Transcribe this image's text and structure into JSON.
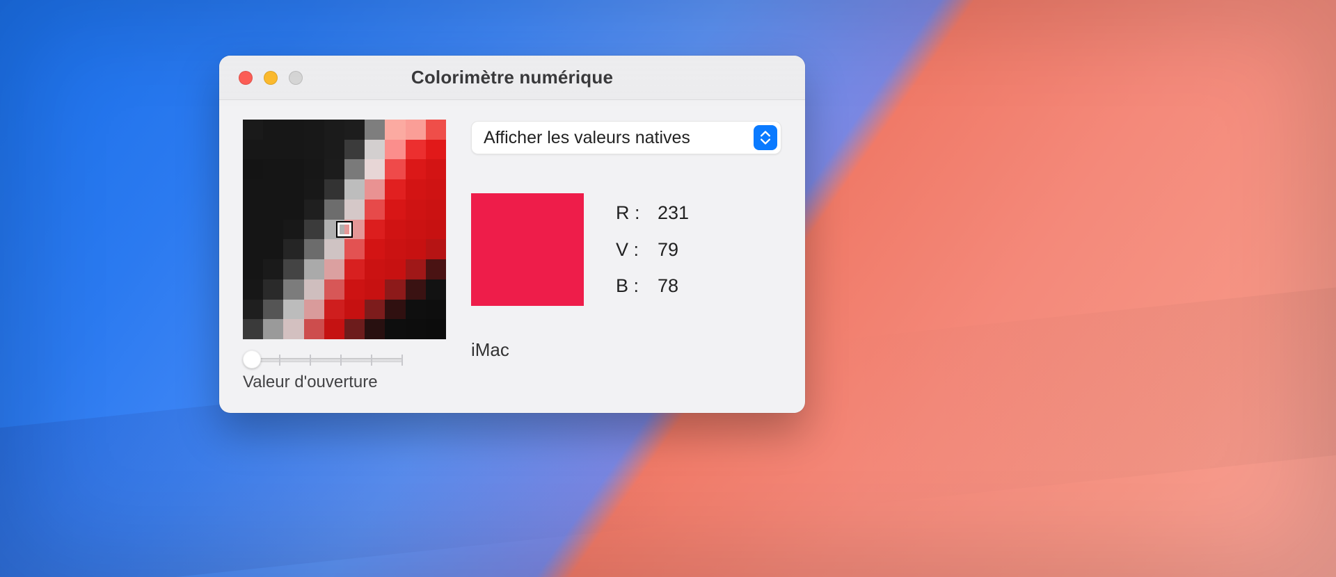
{
  "window": {
    "title": "Colorimètre numérique"
  },
  "select": {
    "value": "Afficher les valeurs natives"
  },
  "sample": {
    "swatch_hex": "#ee1d4a",
    "labels": {
      "r": "R :",
      "g": "V :",
      "b": "B :"
    },
    "r": "231",
    "g": "79",
    "b": "78"
  },
  "display": {
    "name": "iMac"
  },
  "slider": {
    "label": "Valeur d'ouverture"
  },
  "loupe_grid": [
    [
      "#1a1a1a",
      "#171717",
      "#171717",
      "#181818",
      "#1b1b1b",
      "#1d1d1d",
      "#7e7e7e",
      "#fbaaa1",
      "#fa9e97",
      "#ef4e49"
    ],
    [
      "#171717",
      "#171717",
      "#171717",
      "#181818",
      "#1b1b1b",
      "#3b3b3b",
      "#d3cfcf",
      "#fb8e8c",
      "#ec2f2f",
      "#e11919"
    ],
    [
      "#141414",
      "#151515",
      "#151515",
      "#171717",
      "#1c1c1c",
      "#7a7a7a",
      "#e7d6d6",
      "#ef4a4a",
      "#db1818",
      "#d31414"
    ],
    [
      "#151515",
      "#151515",
      "#151515",
      "#181818",
      "#333333",
      "#bdbdbd",
      "#e99292",
      "#e12020",
      "#d31414",
      "#cf1313"
    ],
    [
      "#151515",
      "#151515",
      "#151515",
      "#1f1f1f",
      "#6d6d6d",
      "#d5c8c8",
      "#e74a4a",
      "#d81616",
      "#cf1313",
      "#cb1212"
    ],
    [
      "#151515",
      "#151515",
      "#181818",
      "#3b3b3b",
      "#b0b0b0",
      "#e59797",
      "#dc1e1e",
      "#d01313",
      "#cb1212",
      "#c71111"
    ],
    [
      "#151515",
      "#151515",
      "#252525",
      "#6c6c6c",
      "#cfc3c3",
      "#e35252",
      "#d31414",
      "#cb1212",
      "#c71111",
      "#b61414"
    ],
    [
      "#151515",
      "#1a1a1a",
      "#444444",
      "#aaaaaa",
      "#dba0a0",
      "#d82020",
      "#cb1212",
      "#c71111",
      "#a01818",
      "#4a1313"
    ],
    [
      "#171717",
      "#2a2a2a",
      "#7c7c7c",
      "#cfbebe",
      "#d75757",
      "#cd1313",
      "#c71111",
      "#8d1a1a",
      "#3a1212",
      "#121212"
    ],
    [
      "#1f1f1f",
      "#555555",
      "#bcbcbc",
      "#d99b9b",
      "#cf1e1e",
      "#c61111",
      "#7d1c1c",
      "#301010",
      "#0f0f0f",
      "#0e0e0e"
    ],
    [
      "#3a3a3a",
      "#9a9a9a",
      "#d3c0c0",
      "#cd4d4d",
      "#c51212",
      "#6d1c1c",
      "#281010",
      "#0e0e0e",
      "#0d0d0d",
      "#0c0c0c"
    ]
  ]
}
